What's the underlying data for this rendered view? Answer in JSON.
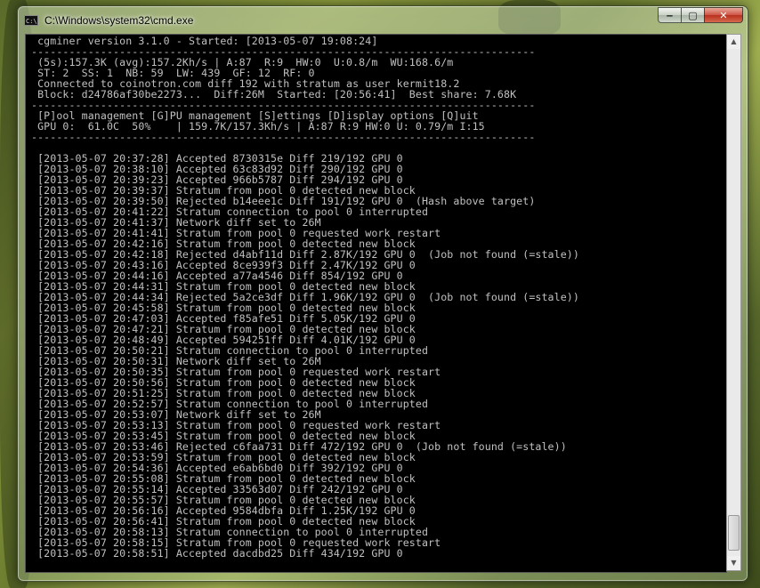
{
  "window": {
    "title": "C:\\Windows\\system32\\cmd.exe",
    "icon_text": "C:\\",
    "buttons": {
      "minimize": "‒",
      "maximize": "▢",
      "close": "✕"
    }
  },
  "header": {
    "banner": " cgminer version 3.1.0 - Started: [2013-05-07 19:08:24]",
    "rule": "--------------------------------------------------------------------------------",
    "stats_1": " (5s):157.3K (avg):157.2Kh/s | A:87  R:9  HW:0  U:0.8/m  WU:168.6/m",
    "stats_2": " ST: 2  SS: 1  NB: 59  LW: 439  GF: 12  RF: 0",
    "stats_3": " Connected to coinotron.com diff 192 with stratum as user kermit18.2",
    "stats_4": " Block: d24786af30be2273...  Diff:26M  Started: [20:56:41]  Best share: 7.68K",
    "menu": " [P]ool management [G]PU management [S]ettings [D]isplay options [Q]uit",
    "gpu": " GPU 0:  61.0C  50%    | 159.7K/157.3Kh/s | A:87 R:9 HW:0 U: 0.79/m I:15"
  },
  "log": [
    " [2013-05-07 20:37:28] Accepted 8730315e Diff 219/192 GPU 0",
    " [2013-05-07 20:38:10] Accepted 63c83d92 Diff 290/192 GPU 0",
    " [2013-05-07 20:39:23] Accepted 966b5787 Diff 294/192 GPU 0",
    " [2013-05-07 20:39:37] Stratum from pool 0 detected new block",
    " [2013-05-07 20:39:50] Rejected b14eee1c Diff 191/192 GPU 0  (Hash above target)",
    " [2013-05-07 20:41:22] Stratum connection to pool 0 interrupted",
    " [2013-05-07 20:41:37] Network diff set to 26M",
    " [2013-05-07 20:41:41] Stratum from pool 0 requested work restart",
    " [2013-05-07 20:42:16] Stratum from pool 0 detected new block",
    " [2013-05-07 20:42:18] Rejected d4abf11d Diff 2.87K/192 GPU 0  (Job not found (=stale))",
    " [2013-05-07 20:43:16] Accepted 8ce939f3 Diff 2.47K/192 GPU 0",
    " [2013-05-07 20:44:16] Accepted a77a4546 Diff 854/192 GPU 0",
    " [2013-05-07 20:44:31] Stratum from pool 0 detected new block",
    " [2013-05-07 20:44:34] Rejected 5a2ce3df Diff 1.96K/192 GPU 0  (Job not found (=stale))",
    " [2013-05-07 20:45:58] Stratum from pool 0 detected new block",
    " [2013-05-07 20:47:03] Accepted f85afe51 Diff 5.05K/192 GPU 0",
    " [2013-05-07 20:47:21] Stratum from pool 0 detected new block",
    " [2013-05-07 20:48:49] Accepted 594251ff Diff 4.01K/192 GPU 0",
    " [2013-05-07 20:50:21] Stratum connection to pool 0 interrupted",
    " [2013-05-07 20:50:31] Network diff set to 26M",
    " [2013-05-07 20:50:35] Stratum from pool 0 requested work restart",
    " [2013-05-07 20:50:56] Stratum from pool 0 detected new block",
    " [2013-05-07 20:51:25] Stratum from pool 0 detected new block",
    " [2013-05-07 20:52:57] Stratum connection to pool 0 interrupted",
    " [2013-05-07 20:53:07] Network diff set to 26M",
    " [2013-05-07 20:53:13] Stratum from pool 0 requested work restart",
    " [2013-05-07 20:53:45] Stratum from pool 0 detected new block",
    " [2013-05-07 20:53:46] Rejected c6faa731 Diff 472/192 GPU 0  (Job not found (=stale))",
    " [2013-05-07 20:53:59] Stratum from pool 0 detected new block",
    " [2013-05-07 20:54:36] Accepted e6ab6bd0 Diff 392/192 GPU 0",
    " [2013-05-07 20:55:08] Stratum from pool 0 detected new block",
    " [2013-05-07 20:55:14] Accepted 33563d07 Diff 242/192 GPU 0",
    " [2013-05-07 20:55:57] Stratum from pool 0 detected new block",
    " [2013-05-07 20:56:16] Accepted 9584dbfa Diff 1.25K/192 GPU 0",
    " [2013-05-07 20:56:41] Stratum from pool 0 detected new block",
    " [2013-05-07 20:58:13] Stratum connection to pool 0 interrupted",
    " [2013-05-07 20:58:15] Stratum from pool 0 requested work restart",
    " [2013-05-07 20:58:51] Accepted dacdbd25 Diff 434/192 GPU 0"
  ]
}
